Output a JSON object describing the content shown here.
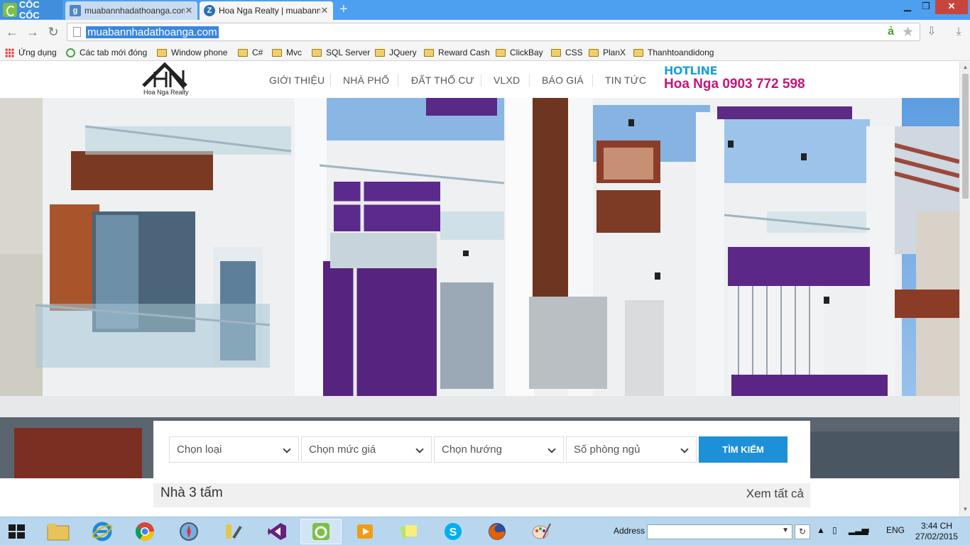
{
  "browser": {
    "brand": "CỐC CỐC",
    "tabs": [
      {
        "title": "muabannhadathoanga.com",
        "favicon": "g"
      },
      {
        "title": "Hoa Nga Realty | muabannhadathoanga.com",
        "favicon": "z"
      }
    ],
    "new_tab_icon": "+",
    "url": "muabannhadathoanga.com",
    "bookmarks": [
      {
        "label": "Ứng dụng",
        "icon": "apps-icon"
      },
      {
        "label": "Các tab mới đóng",
        "icon": "recent-tabs-icon"
      },
      {
        "label": "Window phone",
        "icon": "folder-icon"
      },
      {
        "label": "C#",
        "icon": "folder-icon"
      },
      {
        "label": "Mvc",
        "icon": "folder-icon"
      },
      {
        "label": "SQL Server",
        "icon": "folder-icon"
      },
      {
        "label": "JQuery",
        "icon": "folder-icon"
      },
      {
        "label": "Reward Cash",
        "icon": "folder-icon"
      },
      {
        "label": "ClickBay",
        "icon": "folder-icon"
      },
      {
        "label": "CSS",
        "icon": "folder-icon"
      },
      {
        "label": "PlanX",
        "icon": "folder-icon"
      },
      {
        "label": "Thanhtoandidong",
        "icon": "folder-icon"
      }
    ]
  },
  "site": {
    "logo_text": "Hoa Nga Realty",
    "menu": [
      "GIỚI THIỆU",
      "NHÀ PHỐ",
      "ĐẤT THỔ CƯ",
      "VLXD",
      "BÁO GIÁ",
      "TIN TỨC"
    ],
    "hotline_label": "HOTLINE",
    "hotline_phone": "Hoa Nga 0903 772 598",
    "search": {
      "selects": [
        "Chọn loại",
        "Chọn mức giá",
        "Chọn hướng",
        "Số phòng ngủ"
      ],
      "button": "TÌM KIẾM"
    },
    "listing": {
      "title": "Nhà 3 tấm",
      "view_all": "Xem tất cả"
    }
  },
  "taskbar": {
    "apps": [
      "file-explorer",
      "internet-explorer",
      "chrome",
      "safari",
      "tools",
      "visual-studio",
      "coc-coc",
      "media-player",
      "sticky-notes",
      "skype",
      "firefox",
      "paint"
    ],
    "address_label": "Address",
    "language": "ENG",
    "time": "3:44 CH",
    "date": "27/02/2015"
  },
  "colors": {
    "accent_blue": "#1e90d8",
    "hotline_blue": "#1f9fe0",
    "hotline_magenta": "#c3167a",
    "tabbar_blue": "#4d9ff0"
  }
}
